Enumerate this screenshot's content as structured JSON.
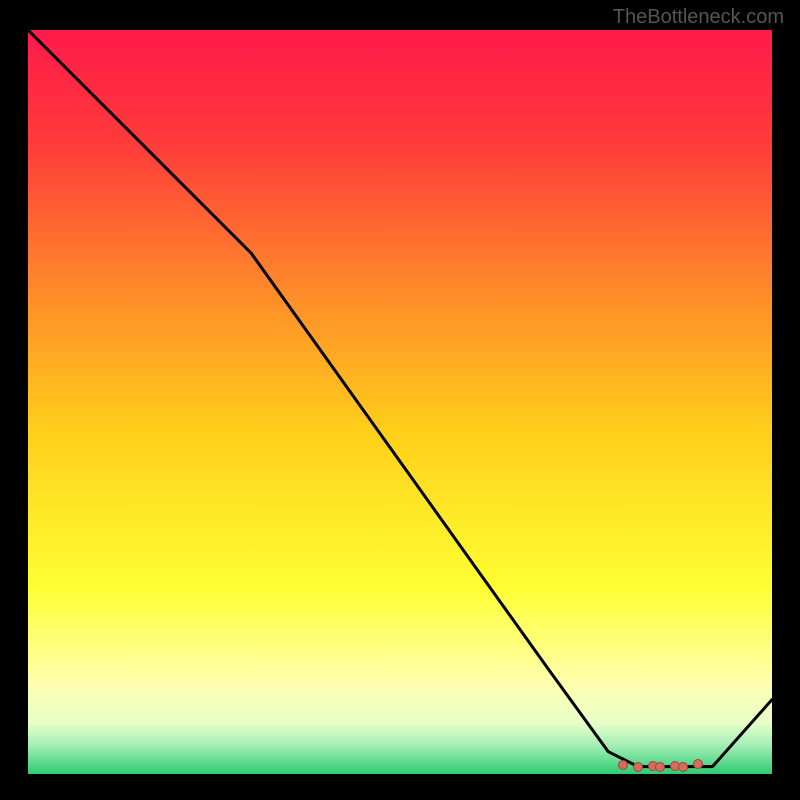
{
  "watermark": "TheBottleneck.com",
  "chart_data": {
    "type": "line",
    "title": "",
    "xlabel": "",
    "ylabel": "",
    "xlim": [
      0,
      100
    ],
    "ylim": [
      0,
      100
    ],
    "curve": {
      "x": [
        0,
        10,
        20,
        25,
        30,
        40,
        50,
        60,
        70,
        78,
        82,
        88,
        92,
        100
      ],
      "y": [
        100,
        90,
        80,
        75,
        70,
        56,
        42,
        28,
        14,
        3,
        1,
        1,
        1,
        10
      ]
    },
    "highlight_cluster": {
      "x": [
        80,
        82,
        84,
        85,
        87,
        88,
        90
      ],
      "y": [
        1.2,
        1.0,
        1.1,
        0.9,
        1.1,
        1.0,
        1.3
      ]
    },
    "gradient_stops": [
      {
        "pos": 0.0,
        "color": "#ff1a4a"
      },
      {
        "pos": 0.15,
        "color": "#ff3a3a"
      },
      {
        "pos": 0.35,
        "color": "#ff8a2a"
      },
      {
        "pos": 0.55,
        "color": "#ffd21a"
      },
      {
        "pos": 0.75,
        "color": "#ffff33"
      },
      {
        "pos": 0.88,
        "color": "#ffffb0"
      },
      {
        "pos": 0.93,
        "color": "#e8ffc8"
      },
      {
        "pos": 0.96,
        "color": "#a8f0b8"
      },
      {
        "pos": 1.0,
        "color": "#2ecc71"
      }
    ]
  }
}
